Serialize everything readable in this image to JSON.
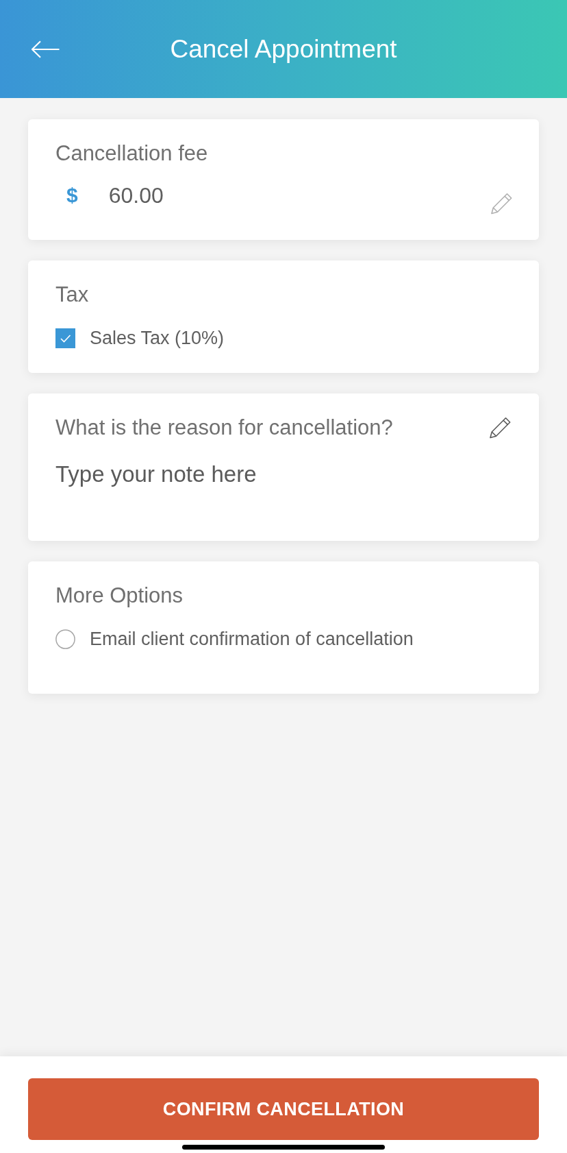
{
  "header": {
    "title": "Cancel Appointment"
  },
  "fee": {
    "label": "Cancellation fee",
    "currency": "$",
    "amount": "60.00"
  },
  "tax": {
    "label": "Tax",
    "options": [
      {
        "kind": "checkbox",
        "label": "Sales Tax (10%)",
        "checked": true
      }
    ]
  },
  "reason": {
    "label": "What is the reason for cancellation?",
    "placeholder": "Type your note here"
  },
  "more_options": {
    "label": "More Options",
    "options": [
      {
        "kind": "radio",
        "label": "Email client confirmation of cancellation",
        "checked": false
      }
    ]
  },
  "confirm_button": {
    "label": "CONFIRM CANCELLATION"
  }
}
